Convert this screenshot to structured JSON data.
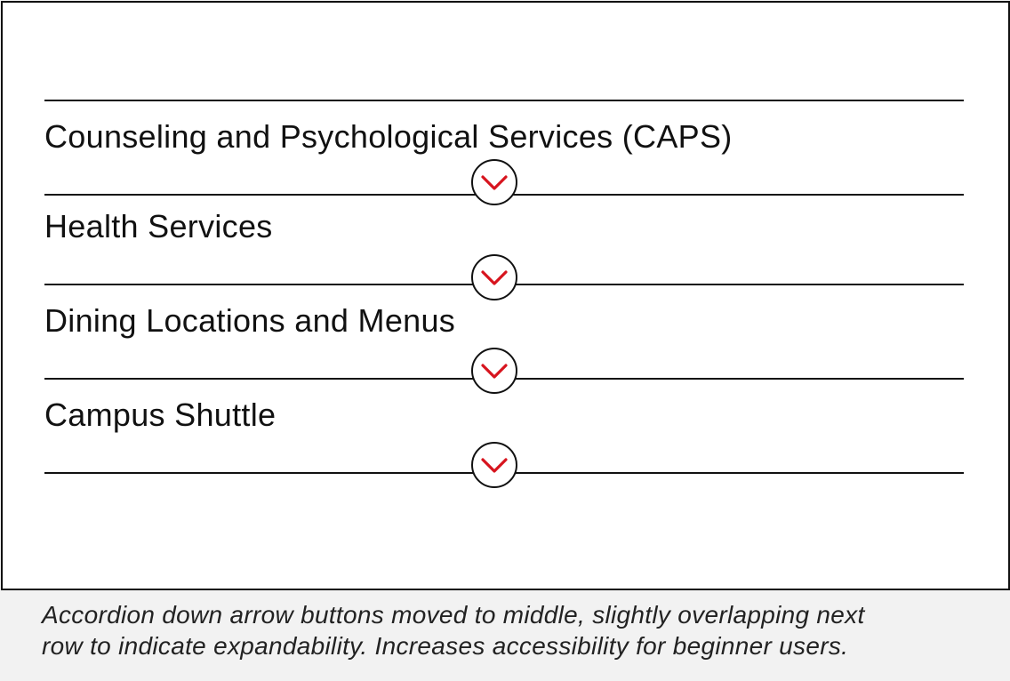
{
  "accordion": {
    "items": [
      {
        "label": "Counseling and Psychological Services (CAPS)",
        "toggle_icon": "chevron-down-icon"
      },
      {
        "label": "Health Services",
        "toggle_icon": "chevron-down-icon"
      },
      {
        "label": "Dining Locations and Menus",
        "toggle_icon": "chevron-down-icon"
      },
      {
        "label": "Campus Shuttle",
        "toggle_icon": "chevron-down-icon"
      }
    ]
  },
  "colors": {
    "chevron": "#d7141e",
    "outline": "#111111",
    "caption_background": "#f2f2f2"
  },
  "caption": {
    "line1": "Accordion down arrow buttons moved to middle, slightly overlapping next",
    "line2": "row to indicate expandability. Increases accessibility for beginner users."
  }
}
